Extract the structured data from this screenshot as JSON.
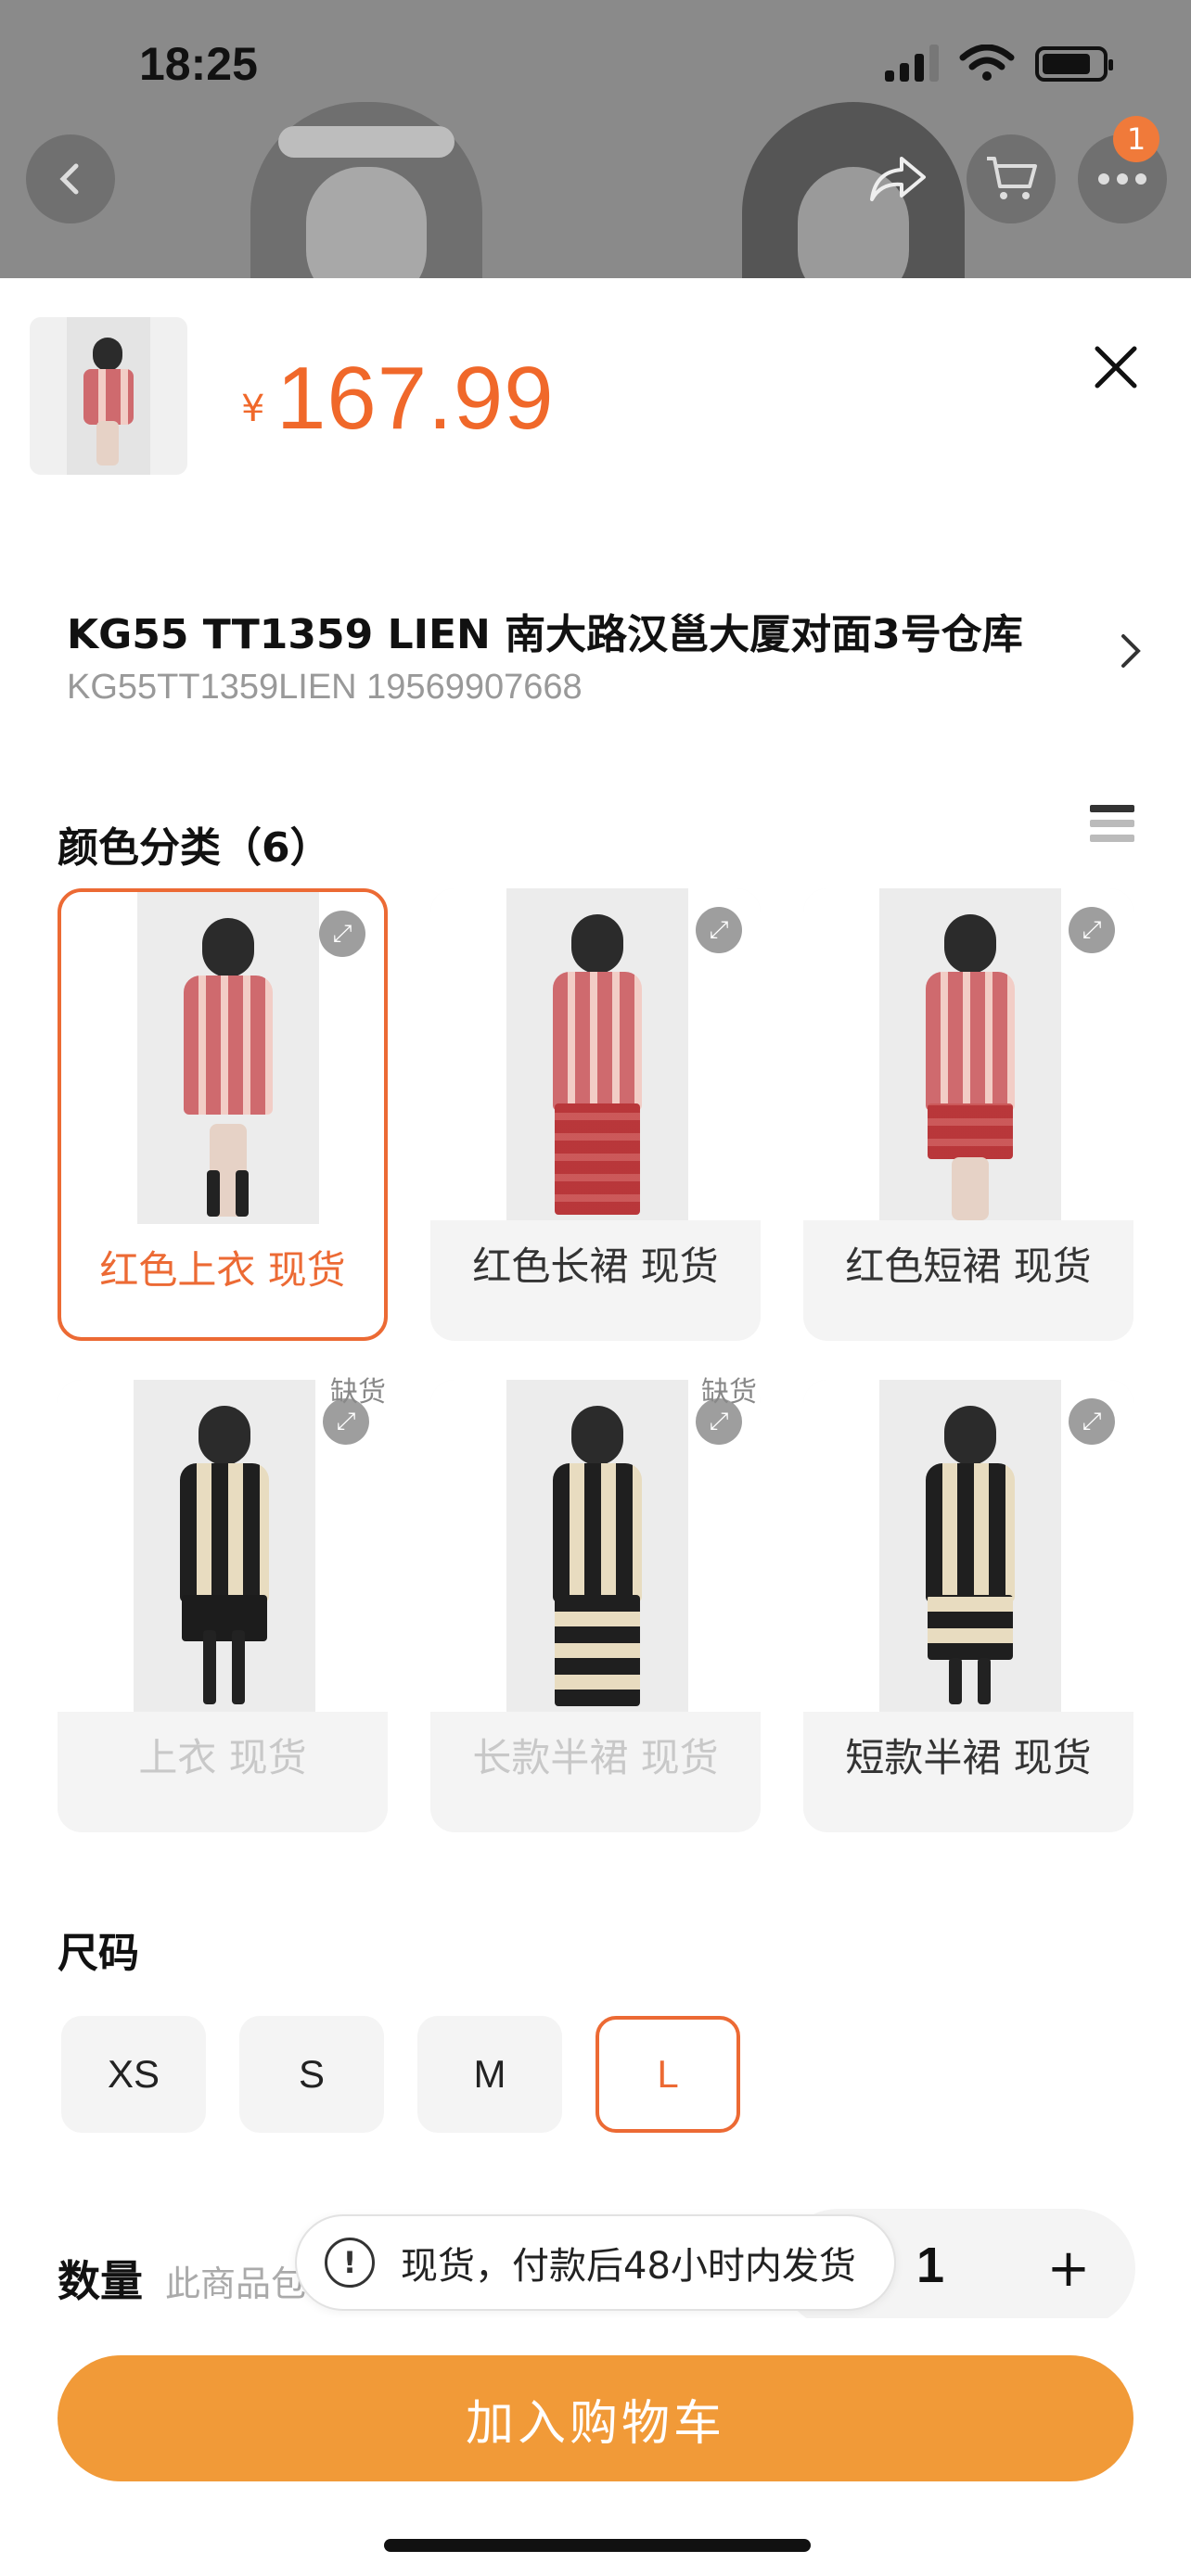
{
  "status_bar": {
    "time": "18:25"
  },
  "header": {
    "cart_badge": "1"
  },
  "product": {
    "currency": "¥",
    "price": "167.99"
  },
  "shop": {
    "title": "KG55 TT1359 LIEN  南大路汉邕大厦对面3号仓库",
    "subtitle": "KG55TT1359LIEN 19569907668"
  },
  "color_section": {
    "title": "颜色分类（6）",
    "options": [
      {
        "label": "红色上衣 现货",
        "selected": true,
        "out_of_stock": false
      },
      {
        "label": "红色长裙 现货",
        "selected": false,
        "out_of_stock": false
      },
      {
        "label": "红色短裙 现货",
        "selected": false,
        "out_of_stock": false
      },
      {
        "label": "上衣 现货",
        "selected": false,
        "out_of_stock": true,
        "tag": "缺货"
      },
      {
        "label": "长款半裙 现货",
        "selected": false,
        "out_of_stock": true,
        "tag": "缺货"
      },
      {
        "label": "短款半裙 现货",
        "selected": false,
        "out_of_stock": false
      }
    ]
  },
  "size_section": {
    "title": "尺码",
    "options": [
      "XS",
      "S",
      "M",
      "L"
    ],
    "selected": "L"
  },
  "quantity": {
    "label": "数量",
    "hint": "此商品包邮",
    "value": "1",
    "plus": "+"
  },
  "toast": {
    "text": "现货，付款后48小时内发货"
  },
  "actions": {
    "add_to_cart": "加入购物车"
  },
  "colors": {
    "accent": "#ec6a34",
    "cart_button": "#f19a38"
  }
}
